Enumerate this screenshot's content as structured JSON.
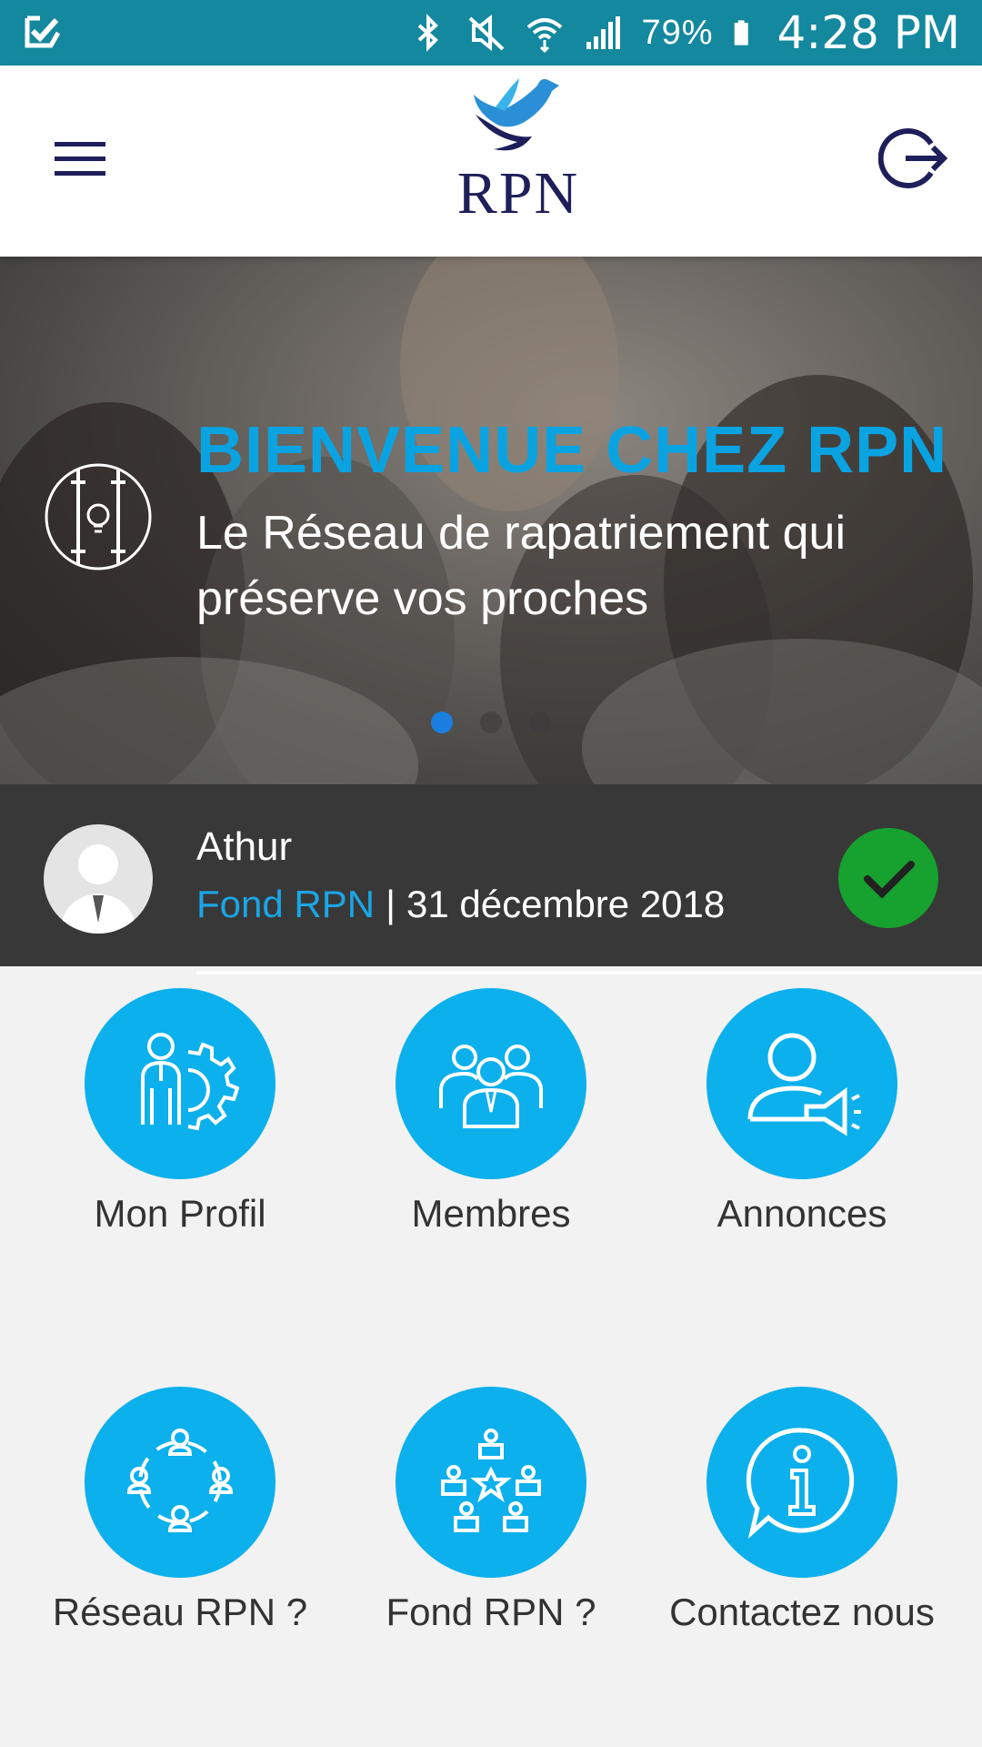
{
  "status_bar": {
    "battery": "79%",
    "time": "4:28 PM",
    "icons": [
      "checkmark-notification-icon",
      "bluetooth-icon",
      "mute-icon",
      "wifi-icon",
      "signal-icon",
      "battery-icon"
    ]
  },
  "header": {
    "logo_text": "RPN",
    "menu_icon": "hamburger-icon",
    "logout_icon": "logout-icon",
    "brand_color": "#1e1f5a"
  },
  "hero": {
    "title": "BIENVENUE CHEZ RPN",
    "subtitle": "Le Réseau de rapatriement qui préserve vos proches",
    "slides_total": 3,
    "active_slide": 1,
    "title_color": "#0aa3e2"
  },
  "user": {
    "name": "Athur",
    "fund": "Fond RPN",
    "separator": "|",
    "date": "31 décembre 2018",
    "status_icon": "check-icon",
    "status_color": "#17a12e"
  },
  "menu": {
    "accent": "#0cb0ec",
    "items": [
      {
        "label": "Mon Profil",
        "icon": "profile-settings-icon"
      },
      {
        "label": "Membres",
        "icon": "members-group-icon"
      },
      {
        "label": "Annonces",
        "icon": "announcement-icon"
      },
      {
        "label": "Réseau RPN ?",
        "icon": "network-icon"
      },
      {
        "label": "Fond RPN ?",
        "icon": "fund-icon"
      },
      {
        "label": "Contactez nous",
        "icon": "info-chat-icon"
      }
    ]
  }
}
